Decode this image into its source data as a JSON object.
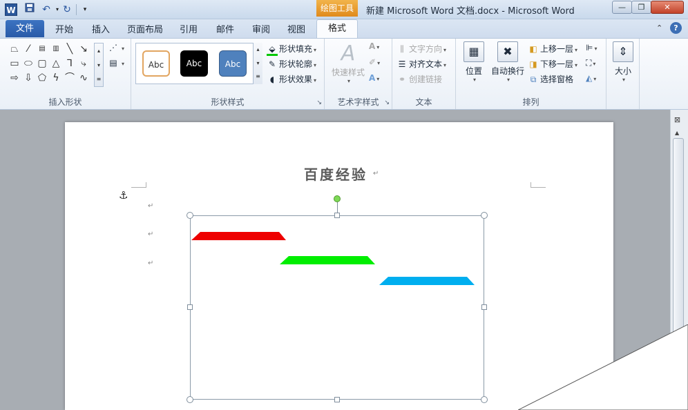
{
  "app": {
    "icon_letter": "W",
    "context_tab": "绘图工具",
    "window_title": "新建 Microsoft Word 文档.docx  -  Microsoft Word"
  },
  "quick_access": [
    "save-icon",
    "undo-icon",
    "redo-icon",
    "customize-icon"
  ],
  "window_controls": {
    "minimize": "—",
    "restore": "❐",
    "close": "✕"
  },
  "tabs": {
    "file": "文件",
    "items": [
      "开始",
      "插入",
      "页面布局",
      "引用",
      "邮件",
      "审阅",
      "视图"
    ],
    "format": "格式"
  },
  "ribbon": {
    "insert_shapes": {
      "label": "插入形状"
    },
    "shape_styles": {
      "label": "形状样式",
      "tiles": [
        "Abc",
        "Abc",
        "Abc"
      ],
      "fill": "形状填充",
      "outline": "形状轮廓",
      "effects": "形状效果"
    },
    "wordart": {
      "label": "艺术字样式",
      "quick_styles": "快速样式"
    },
    "text": {
      "label": "文本",
      "direction": "文字方向",
      "align": "对齐文本",
      "link": "创建链接"
    },
    "arrange": {
      "label": "排列",
      "position": "位置",
      "wrap": "自动换行",
      "bring_forward": "上移一层",
      "send_backward": "下移一层",
      "selection_pane": "选择窗格"
    },
    "size": {
      "label": "大小"
    }
  },
  "document": {
    "title": "百度经验",
    "shapes": [
      {
        "name": "red-trapezoid",
        "color": "#ee0000"
      },
      {
        "name": "green-trapezoid",
        "color": "#00ee00"
      },
      {
        "name": "blue-trapezoid",
        "color": "#00aeef"
      }
    ]
  },
  "colors": {
    "file_tab": "#2a5ba8",
    "context_tab": "#e08a1c",
    "rotate_handle": "#7ed957"
  }
}
